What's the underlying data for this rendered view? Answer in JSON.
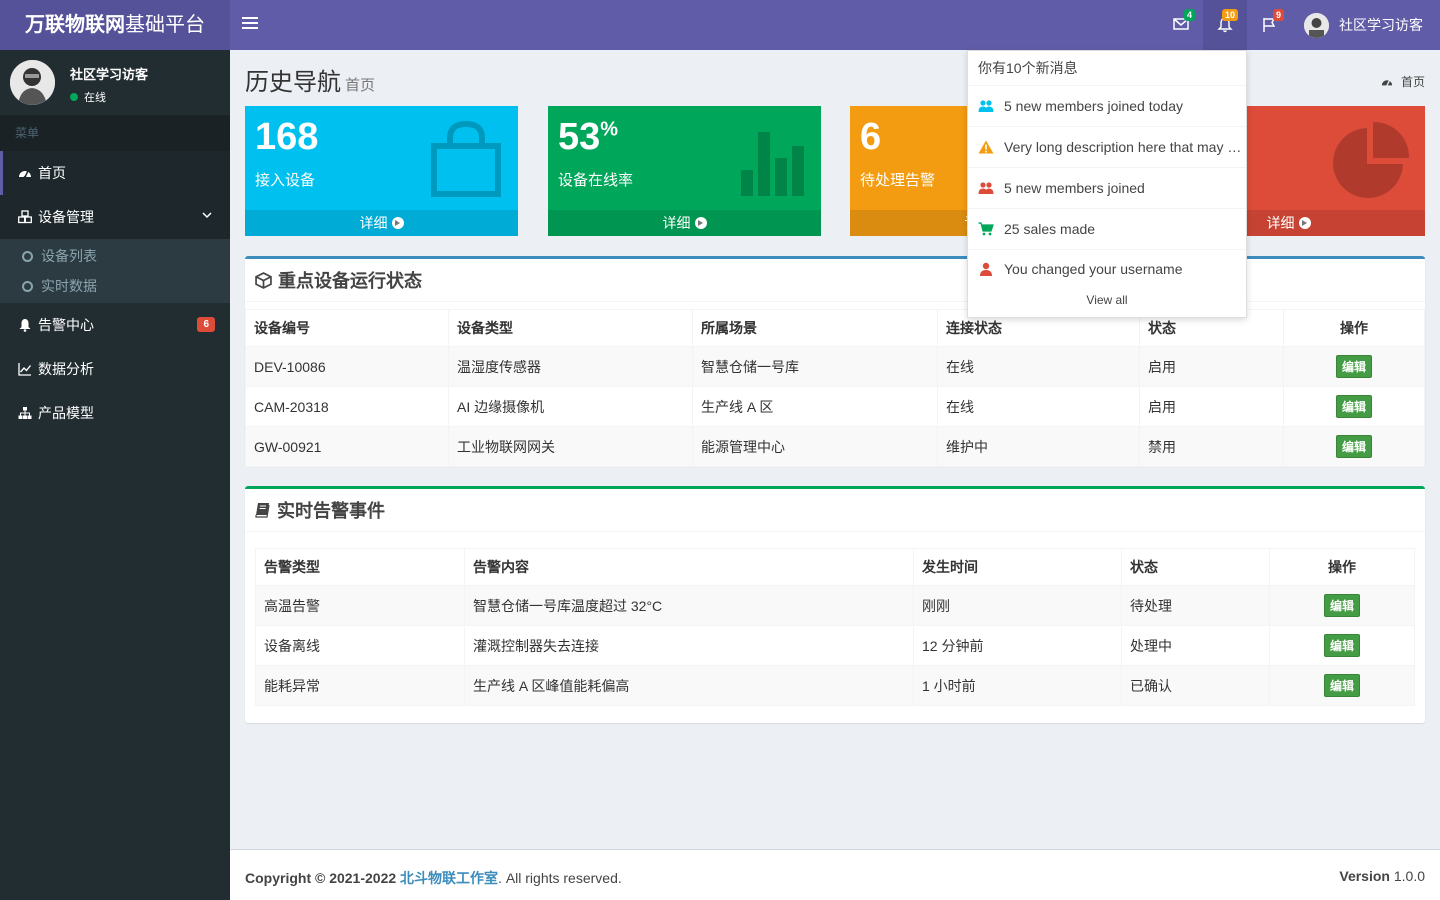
{
  "app": {
    "logo_bold": "万联物联网",
    "logo_light": "基础平台"
  },
  "navbar": {
    "mail_count": "4",
    "notif_count": "10",
    "flag_count": "9",
    "user_name": "社区学习访客"
  },
  "sidebar": {
    "user_name": "社区学习访客",
    "user_status": "在线",
    "menu_header": "菜单",
    "items": [
      {
        "label": "首页",
        "icon": "dashboard-icon"
      },
      {
        "label": "设备管理",
        "icon": "cubes-icon"
      },
      {
        "label": "告警中心",
        "icon": "bell-icon",
        "badge": "6"
      },
      {
        "label": "数据分析",
        "icon": "line-chart-icon"
      },
      {
        "label": "产品模型",
        "icon": "sitemap-icon"
      }
    ],
    "sub_items": [
      {
        "label": "设备列表"
      },
      {
        "label": "实时数据"
      }
    ]
  },
  "header": {
    "title": "历史导航",
    "subtitle": "首页",
    "breadcrumb": "首页"
  },
  "tiles": [
    {
      "value": "168",
      "unit": "",
      "label": "接入设备",
      "footer": "详细",
      "color": "#00c0ef",
      "icon": "shopping-bag-icon"
    },
    {
      "value": "53",
      "unit": "%",
      "label": "设备在线率",
      "footer": "详细",
      "color": "#00a65a",
      "icon": "bar-chart-icon"
    },
    {
      "value": "6",
      "unit": "",
      "label": "待处理告警",
      "footer": "详细",
      "color": "#f39c12",
      "icon": "user-plus-icon"
    },
    {
      "value": "",
      "unit": "",
      "label": "",
      "footer": "详细",
      "color": "#dd4b39",
      "icon": "pie-chart-icon"
    }
  ],
  "devices": {
    "title": "重点设备运行状态",
    "headers": [
      "设备编号",
      "设备类型",
      "所属场景",
      "连接状态",
      "状态",
      "操作"
    ],
    "rows": [
      [
        "DEV-10086",
        "温湿度传感器",
        "智慧仓储一号库",
        "在线",
        "启用",
        "编辑"
      ],
      [
        "CAM-20318",
        "AI 边缘摄像机",
        "生产线 A 区",
        "在线",
        "启用",
        "编辑"
      ],
      [
        "GW-00921",
        "工业物联网网关",
        "能源管理中心",
        "维护中",
        "禁用",
        "编辑"
      ]
    ]
  },
  "alerts": {
    "title": "实时告警事件",
    "headers": [
      "告警类型",
      "告警内容",
      "发生时间",
      "状态",
      "操作"
    ],
    "rows": [
      [
        "高温告警",
        "智慧仓储一号库温度超过 32°C",
        "刚刚",
        "待处理",
        "编辑"
      ],
      [
        "设备离线",
        "灌溉控制器失去连接",
        "12 分钟前",
        "处理中",
        "编辑"
      ],
      [
        "能耗异常",
        "生产线 A 区峰值能耗偏高",
        "1 小时前",
        "已确认",
        "编辑"
      ]
    ]
  },
  "notifications": {
    "header": "你有10个新消息",
    "items": [
      {
        "text": "5 new members joined today",
        "icon": "users-icon",
        "color": "#00c0ef"
      },
      {
        "text": "Very long description here that may not fit into the page and may cause design problems",
        "icon": "warning-icon",
        "color": "#f39c12"
      },
      {
        "text": "5 new members joined",
        "icon": "users-icon",
        "color": "#dd4b39"
      },
      {
        "text": "25 sales made",
        "icon": "shopping-cart-icon",
        "color": "#00a65a"
      },
      {
        "text": "You changed your username",
        "icon": "user-icon",
        "color": "#dd4b39"
      }
    ],
    "footer": "View all"
  },
  "footer": {
    "copyright": "Copyright © 2021-2022",
    "company": "北斗物联工作室",
    "rights": ". All rights reserved.",
    "version_label": "Version",
    "version": "1.0.0"
  }
}
